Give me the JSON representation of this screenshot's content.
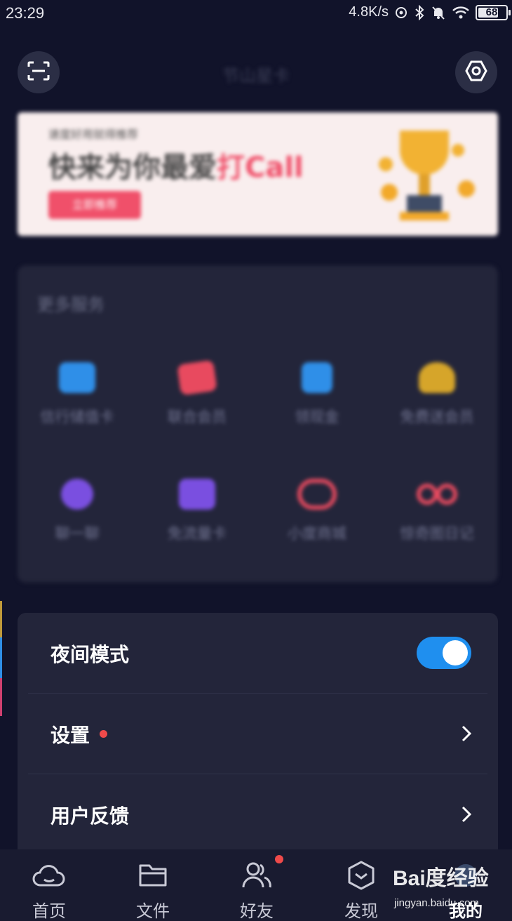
{
  "status_bar": {
    "time": "23:29",
    "net_speed": "4.8K/s",
    "battery": "68"
  },
  "header": {
    "title": "节山星卡"
  },
  "banner": {
    "subtitle": "速度好用就得推荐",
    "title_main": "快来为你最爱",
    "title_accent": "打Call",
    "button_label": "立即推荐"
  },
  "services": {
    "title": "更多服务",
    "items": [
      {
        "label": "信行储值卡",
        "icon": "card-icon",
        "color": "#2f8fe8"
      },
      {
        "label": "联合会员",
        "icon": "ticket-icon",
        "color": "#e84a5f"
      },
      {
        "label": "领现金",
        "icon": "wallet-icon",
        "color": "#2f8fe8"
      },
      {
        "label": "免费送会员",
        "icon": "gift-icon",
        "color": "#d6a52a"
      },
      {
        "label": "聊一聊",
        "icon": "chat-icon",
        "color": "#7a4fe0"
      },
      {
        "label": "免流量卡",
        "icon": "sim-icon",
        "color": "#7a4fe0"
      },
      {
        "label": "小度商城",
        "icon": "shop-icon",
        "color": "#e84a5f"
      },
      {
        "label": "惊奇图日记",
        "icon": "infinity-icon",
        "color": "#e84a5f"
      }
    ]
  },
  "settings": {
    "night_mode_label": "夜间模式",
    "night_mode_on": true,
    "settings_label": "设置",
    "feedback_label": "用户反馈"
  },
  "bottom_nav": {
    "items": [
      {
        "label": "首页",
        "icon": "cloud-icon"
      },
      {
        "label": "文件",
        "icon": "folder-icon"
      },
      {
        "label": "好友",
        "icon": "friends-icon"
      },
      {
        "label": "发现",
        "icon": "discover-icon"
      },
      {
        "label": "我的",
        "icon": "profile-icon"
      }
    ]
  },
  "watermark": {
    "main": "Bai度经验",
    "sub": "jingyan.baidu.com"
  },
  "colors": {
    "background": "#11132a",
    "card": "#23253a",
    "toggle_on": "#1f8fef",
    "badge": "#ef4a4a"
  }
}
